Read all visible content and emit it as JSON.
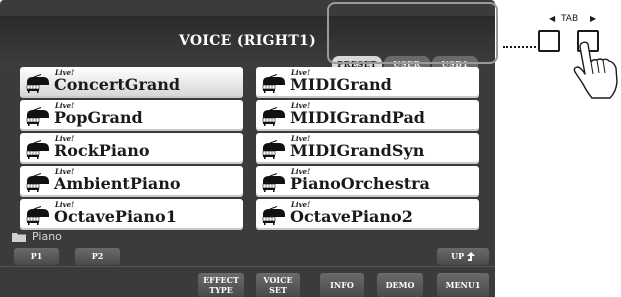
{
  "screen": {
    "title": "VOICE (RIGHT1)",
    "tabs": [
      {
        "label": "PRESET",
        "active": true
      },
      {
        "label": "USER",
        "active": false
      },
      {
        "label": "USB1",
        "active": false
      }
    ],
    "voices_left": [
      {
        "badge": "Live!",
        "name": "ConcertGrand",
        "selected": true
      },
      {
        "badge": "Live!",
        "name": "PopGrand",
        "selected": false
      },
      {
        "badge": "Live!",
        "name": "RockPiano",
        "selected": false
      },
      {
        "badge": "Live!",
        "name": "AmbientPiano",
        "selected": false
      },
      {
        "badge": "Live!",
        "name": "OctavePiano1",
        "selected": false
      }
    ],
    "voices_right": [
      {
        "badge": "Live!",
        "name": "MIDIGrand",
        "selected": false
      },
      {
        "badge": "Live!",
        "name": "MIDIGrandPad",
        "selected": false
      },
      {
        "badge": "Live!",
        "name": "MIDIGrandSyn",
        "selected": false
      },
      {
        "badge": "Live!",
        "name": "PianoOrchestra",
        "selected": false
      },
      {
        "badge": "Live!",
        "name": "OctavePiano2",
        "selected": false
      }
    ],
    "voice_icon": "grand-piano-icon",
    "folder": {
      "icon": "folder-icon",
      "label": "Piano"
    },
    "pages": [
      "P1",
      "P2"
    ],
    "up_label": "UP",
    "up_icon": "up-arrow-icon",
    "bottom_buttons": {
      "effect_type": [
        "EFFECT",
        "TYPE"
      ],
      "voice_set": [
        "VOICE",
        "SET"
      ],
      "info": "INFO",
      "demo": "DEMO",
      "menu": "MENU1"
    }
  },
  "panel": {
    "tab_label": "TAB",
    "left_arrow": "◀",
    "right_arrow": "▶"
  },
  "colors": {
    "screen_bg": "#3b3b3b",
    "voice_button": "#ffffff",
    "active_tab": "#d8d8d8",
    "highlight_frame": "#9a9a9a"
  }
}
